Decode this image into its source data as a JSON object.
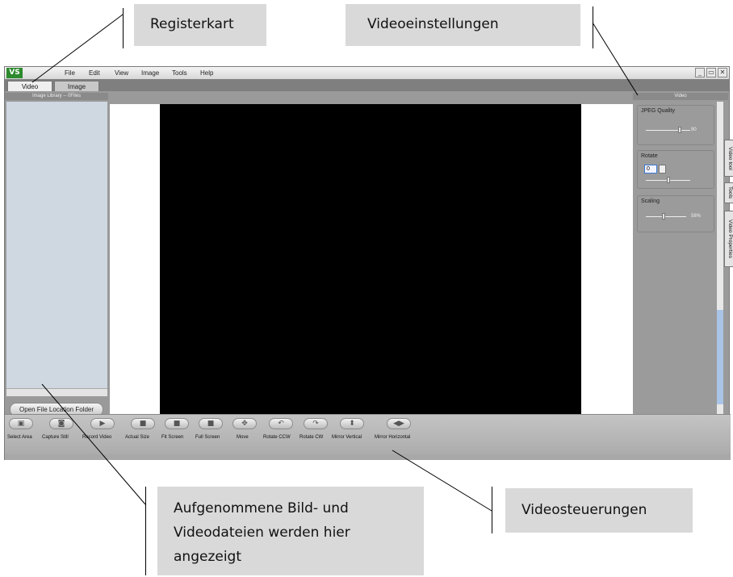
{
  "callouts": {
    "registerkarte": "Registerkart",
    "videoeinstellungen": "Videoeinstellungen",
    "dateien_line1": "Aufgenommene Bild- und",
    "dateien_line2": "Videodateien werden hier",
    "dateien_line3": "angezeigt",
    "videosteuerungen": "Videosteuerungen"
  },
  "app": {
    "logo": "VS",
    "menu": [
      "File",
      "Edit",
      "View",
      "Image",
      "Tools",
      "Help"
    ],
    "window_buttons": [
      "_",
      "▭",
      "✕"
    ],
    "tabs": [
      "Video",
      "Image"
    ],
    "library_header": "Image Library -- 0Files",
    "open_folder_button": "Open File Location Folder",
    "right_panel": {
      "header": "Video",
      "jpeg_quality_label": "JPEG Quality",
      "jpeg_quality_value": "90",
      "rotate_label": "Rotate",
      "rotate_value": "0",
      "scaling_label": "Scaling",
      "scaling_value": "58%"
    },
    "side_tabs": [
      "Video tool",
      "Tools",
      "Video Properties"
    ],
    "toolbar": [
      {
        "label": "Select Area",
        "icon": "select-area-icon",
        "glyph": "▣"
      },
      {
        "label": "Capture Still",
        "icon": "camera-icon",
        "glyph": "◙"
      },
      {
        "label": "Record Video",
        "icon": "record-icon",
        "glyph": "▶"
      },
      {
        "label": "Actual Size",
        "icon": "actual-size-icon",
        "glyph": "■"
      },
      {
        "label": "Fit Screen",
        "icon": "fit-screen-icon",
        "glyph": "■"
      },
      {
        "label": "Full Screen",
        "icon": "full-screen-icon",
        "glyph": "■"
      },
      {
        "label": "Move",
        "icon": "move-icon",
        "glyph": "✥"
      },
      {
        "label": "Rotate CCW",
        "icon": "rotate-ccw-icon",
        "glyph": "↶"
      },
      {
        "label": "Rotate CW",
        "icon": "rotate-cw-icon",
        "glyph": "↷"
      },
      {
        "label": "Mirror Vertical",
        "icon": "mirror-vertical-icon",
        "glyph": "⬍"
      },
      {
        "label": "Mirror Horizontal",
        "icon": "mirror-horizontal-icon",
        "glyph": "◀▶"
      }
    ]
  }
}
